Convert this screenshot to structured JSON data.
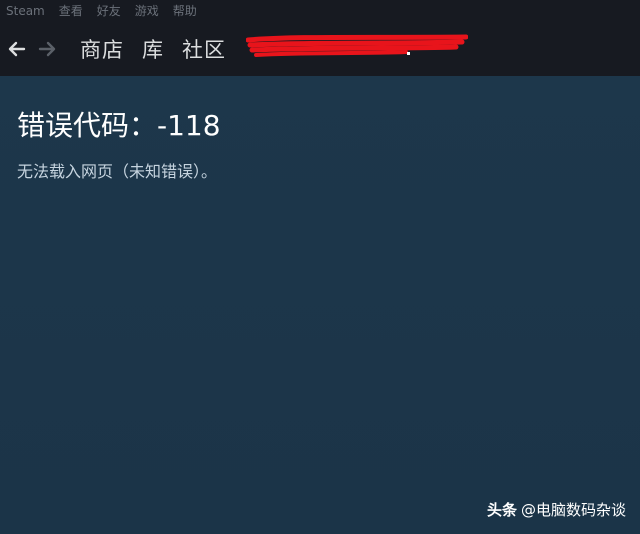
{
  "menubar": {
    "items": [
      "Steam",
      "查看",
      "好友",
      "游戏",
      "帮助"
    ]
  },
  "navbar": {
    "back_icon": "arrow-left-icon",
    "forward_icon": "arrow-right-icon",
    "links": [
      "商店",
      "库",
      "社区"
    ]
  },
  "error": {
    "title": "错误代码：-118",
    "message": "无法载入网页（未知错误）。"
  },
  "watermark": {
    "brand": "头条",
    "handle": "@电脑数码杂谈"
  },
  "colors": {
    "chrome": "#171a21",
    "content_bg": "#1c3549",
    "title": "#ffffff",
    "message": "#c6d4df",
    "redaction": "#e8141b"
  }
}
